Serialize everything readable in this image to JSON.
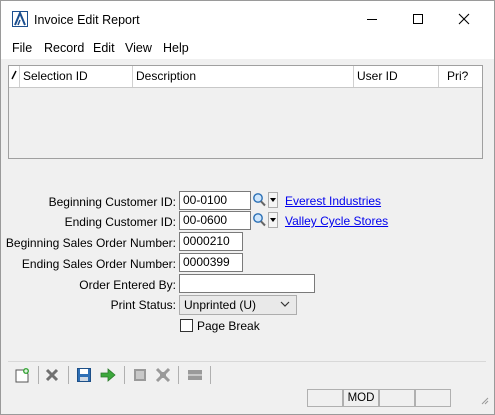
{
  "window": {
    "title": "Invoice Edit Report"
  },
  "menu": {
    "items": [
      "File",
      "Record",
      "Edit",
      "View",
      "Help"
    ]
  },
  "grid": {
    "columns": [
      "Selection ID",
      "Description",
      "User ID",
      "Pri?"
    ],
    "rows": []
  },
  "form": {
    "beginning_customer": {
      "label": "Beginning Customer ID:",
      "value": "00-0100",
      "link": "Everest Industries"
    },
    "ending_customer": {
      "label": "Ending Customer ID:",
      "value": "00-0600",
      "link": "Valley Cycle Stores"
    },
    "beginning_order": {
      "label": "Beginning Sales Order Number:",
      "value": "0000210"
    },
    "ending_order": {
      "label": "Ending Sales Order Number:",
      "value": "0000399"
    },
    "entered_by": {
      "label": "Order Entered By:",
      "value": ""
    },
    "print_status": {
      "label": "Print Status:",
      "value": "Unprinted (U)"
    },
    "page_break": {
      "label": "Page Break",
      "checked": false
    }
  },
  "statusbar": {
    "panes": [
      "",
      "MOD",
      "",
      ""
    ]
  },
  "colors": {
    "link": "#0000ee",
    "accent": "#1c6fbf"
  }
}
